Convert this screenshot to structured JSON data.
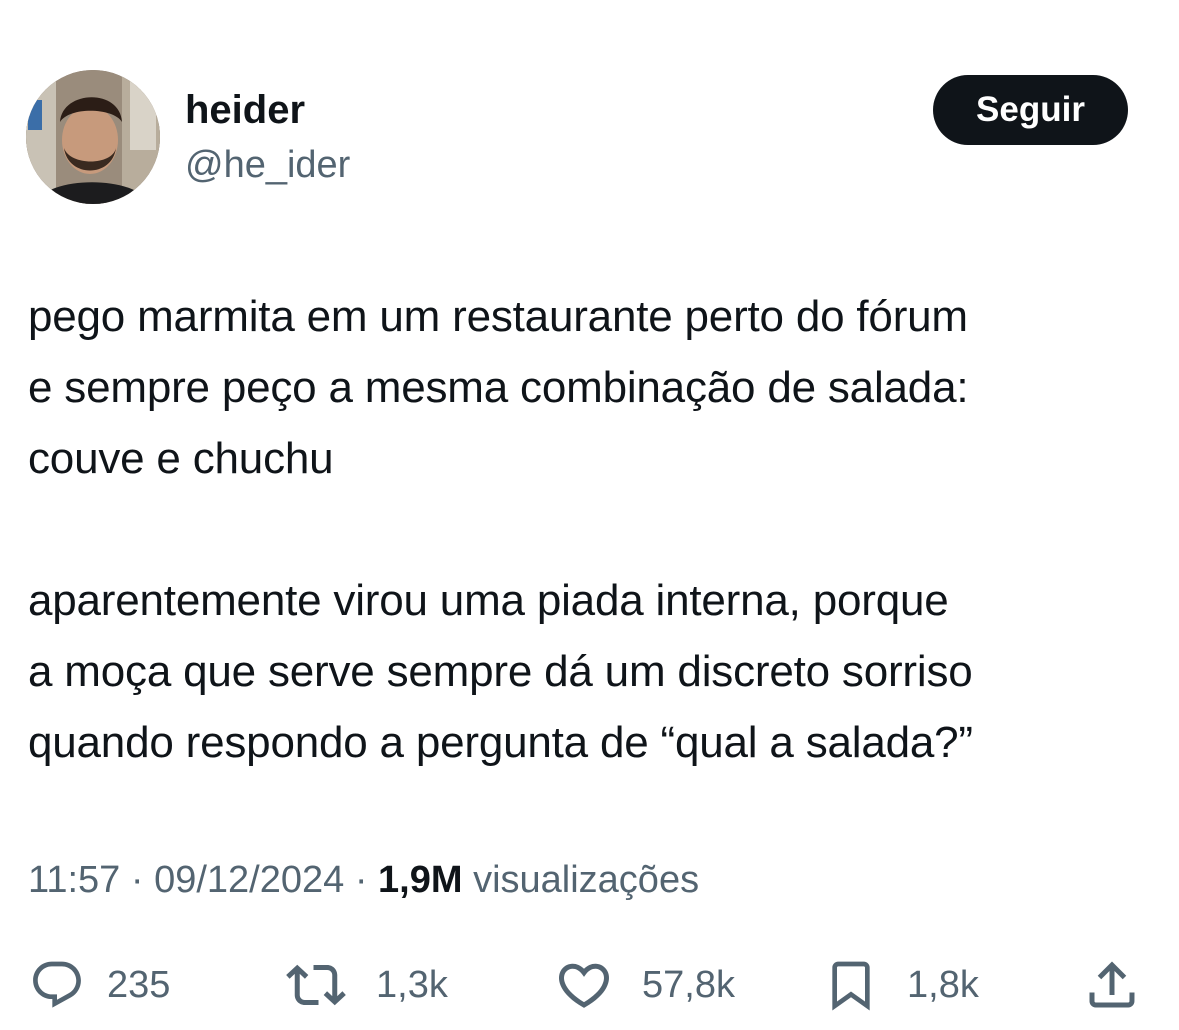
{
  "user": {
    "display_name": "heider",
    "handle": "@he_ider"
  },
  "follow_button": {
    "label": "Seguir"
  },
  "tweet": {
    "paragraphs": [
      "pego marmita em um restaurante perto do fórum\ne sempre peço a mesma combinação de salada:\ncouve e chuchu",
      "aparentemente virou uma piada interna, porque\na moça que serve sempre dá um discreto sorriso\nquando respondo a pergunta de “qual a salada?”"
    ],
    "time": "11:57",
    "date": "09/12/2024",
    "separator": "·",
    "views_count": "1,9M",
    "views_label": "visualizações"
  },
  "actions": {
    "replies": {
      "icon": "reply-icon",
      "count": "235"
    },
    "retweets": {
      "icon": "retweet-icon",
      "count": "1,3k"
    },
    "likes": {
      "icon": "heart-icon",
      "count": "57,8k"
    },
    "bookmarks": {
      "icon": "bookmark-icon",
      "count": "1,8k"
    },
    "share": {
      "icon": "share-icon"
    }
  },
  "colors": {
    "text_primary": "#0f1419",
    "text_secondary": "#536471",
    "button_bg": "#0f1419",
    "button_text": "#ffffff"
  }
}
